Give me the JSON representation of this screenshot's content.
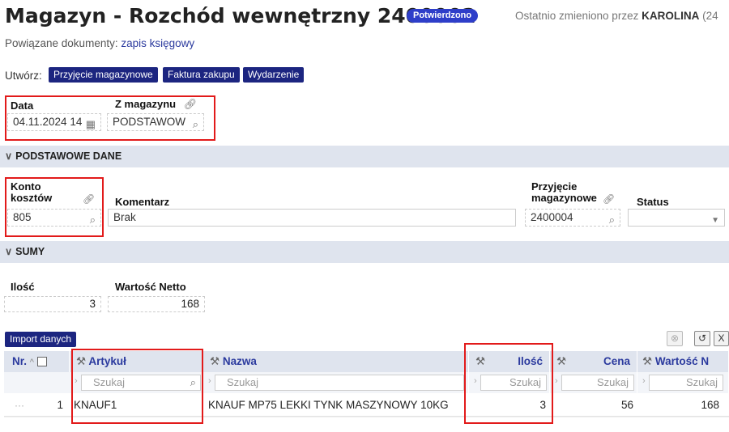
{
  "header": {
    "title": "Magazyn - Rozchód wewnętrzny 2400002",
    "status": "Potwierdzono",
    "modified_prefix": "Ostatnio zmieniono przez ",
    "modified_user": "KAROLINA",
    "modified_suffix": " (24"
  },
  "related": {
    "label": "Powiązane dokumenty: ",
    "link": "zapis księgowy"
  },
  "create": {
    "label": "Utwórz:",
    "buttons": [
      "Przyjęcie magazynowe",
      "Faktura zakupu",
      "Wydarzenie"
    ]
  },
  "top_fields": {
    "date_label": "Data",
    "date_value": "04.11.2024 14",
    "warehouse_label": "Z magazynu",
    "warehouse_value": "PODSTAWOW"
  },
  "sections": {
    "basic": "PODSTAWOWE DANE",
    "sums": "SUMY"
  },
  "basic": {
    "account_label_1": "Konto",
    "account_label_2": "kosztów",
    "account_value": "805",
    "comment_label": "Komentarz",
    "comment_value": "Brak",
    "receipt_label_1": "Przyjęcie",
    "receipt_label_2": "magazynowe",
    "receipt_value": "2400004",
    "status_label": "Status",
    "status_value": ""
  },
  "sums": {
    "qty_label": "Ilość",
    "qty_value": "3",
    "net_label": "Wartość Netto",
    "net_value": "168"
  },
  "grid": {
    "import_button": "Import danych",
    "columns": {
      "nr": "Nr.",
      "article": "Artykuł",
      "name": "Nazwa",
      "qty": "Ilość",
      "price": "Cena",
      "value": "Wartość N"
    },
    "search_placeholder": "Szukaj",
    "rows": [
      {
        "dots": "···",
        "nr": "1",
        "article": "KNAUF1",
        "name": "KNAUF MP75 LEKKI TYNK MASZYNOWY 10KG",
        "qty": "3",
        "price": "56",
        "value": "168"
      }
    ]
  },
  "colors": {
    "accent": "#2e3ec9",
    "dark_button": "#1c2580",
    "highlight": "#e21a1a",
    "section_bg": "#dfe4ee"
  }
}
